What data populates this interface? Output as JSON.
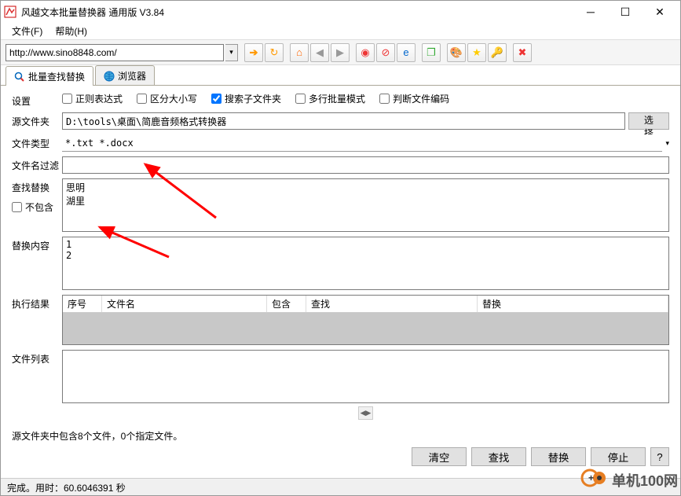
{
  "titlebar": {
    "title": "风越文本批量替换器 通用版  V3.84"
  },
  "menu": {
    "file": "文件(F)",
    "help": "帮助(H)"
  },
  "toolbar": {
    "url": "http://www.sino8848.com/"
  },
  "tabs": {
    "batch": "批量查找替换",
    "browser": "浏览器"
  },
  "labels": {
    "settings": "设置",
    "sourceFolder": "源文件夹",
    "fileType": "文件类型",
    "fileNameFilter": "文件名过滤",
    "findReplace": "查找替换",
    "exclude": "不包含",
    "replaceContent": "替换内容",
    "execResult": "执行结果",
    "fileList": "文件列表"
  },
  "checkboxes": {
    "regex": "正则表达式",
    "caseSensitive": "区分大小写",
    "searchSubfolder": "搜索子文件夹",
    "multiline": "多行批量模式",
    "detectEncoding": "判断文件编码"
  },
  "fields": {
    "sourceFolder": "D:\\tools\\桌面\\简鹿音频格式转换器",
    "selectBtn": "选择",
    "fileType": "*.txt *.docx",
    "fileNameFilter": "",
    "findText": "思明\n湖里",
    "replaceText": "1\n2"
  },
  "resultTable": {
    "cols": [
      "序号",
      "文件名",
      "包含",
      "查找",
      "替换"
    ]
  },
  "summary": "源文件夹中包含8个文件，0个指定文件。",
  "buttons": {
    "clear": "清空",
    "find": "查找",
    "replace": "替换",
    "stop": "停止",
    "help": "?"
  },
  "statusbar": "完成。用时：60.6046391 秒",
  "watermark": "单机100网"
}
